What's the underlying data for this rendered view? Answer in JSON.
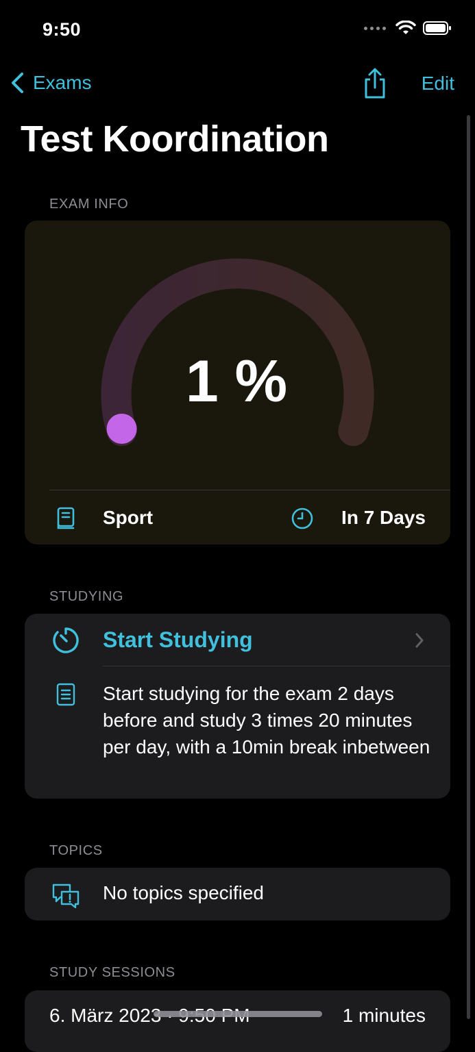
{
  "status_bar": {
    "time": "9:50"
  },
  "nav": {
    "back_label": "Exams",
    "edit_label": "Edit"
  },
  "page": {
    "title": "Test Koordination"
  },
  "exam_info": {
    "header": "EXAM INFO",
    "progress_text": "1 %",
    "progress_value": 0.01,
    "subject": "Sport",
    "due": "In 7 Days",
    "colors": {
      "ring_start": "#c466e8",
      "track": "#3a2630",
      "card": "#1a170c"
    }
  },
  "studying": {
    "header": "STUDYING",
    "start_label": "Start Studying",
    "plan": "Start studying for the exam 2 days before and study 3 times 20 minutes per day, with a 10min break inbetween"
  },
  "topics": {
    "header": "TOPICS",
    "empty_text": "No topics specified"
  },
  "sessions": {
    "header": "STUDY SESSIONS",
    "items": [
      {
        "date": "6. März 2023 · 9:50 PM",
        "duration": "1 minutes"
      }
    ]
  },
  "accent_color": "#40c0dc",
  "icons": [
    "chevron-left-icon",
    "share-icon",
    "book-icon",
    "clock-icon",
    "timer-icon",
    "list-icon",
    "topics-bubble-icon",
    "chevron-right-icon"
  ]
}
